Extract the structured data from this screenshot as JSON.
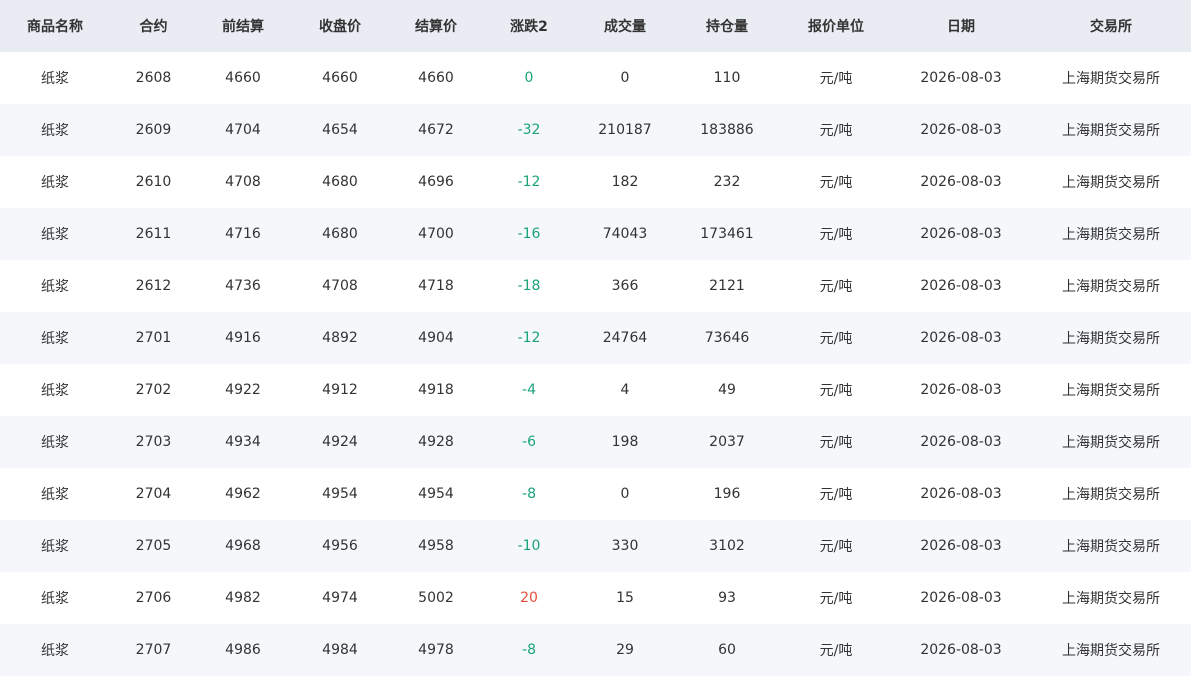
{
  "table": {
    "columns": [
      "商品名称",
      "合约",
      "前结算",
      "收盘价",
      "结算价",
      "涨跌2",
      "成交量",
      "持仓量",
      "报价单位",
      "日期",
      "交易所"
    ],
    "rows": [
      [
        "纸浆",
        "2608",
        "4660",
        "4660",
        "4660",
        "0",
        "0",
        "110",
        "元/吨",
        "2026-08-03",
        "上海期货交易所"
      ],
      [
        "纸浆",
        "2609",
        "4704",
        "4654",
        "4672",
        "-32",
        "210187",
        "183886",
        "元/吨",
        "2026-08-03",
        "上海期货交易所"
      ],
      [
        "纸浆",
        "2610",
        "4708",
        "4680",
        "4696",
        "-12",
        "182",
        "232",
        "元/吨",
        "2026-08-03",
        "上海期货交易所"
      ],
      [
        "纸浆",
        "2611",
        "4716",
        "4680",
        "4700",
        "-16",
        "74043",
        "173461",
        "元/吨",
        "2026-08-03",
        "上海期货交易所"
      ],
      [
        "纸浆",
        "2612",
        "4736",
        "4708",
        "4718",
        "-18",
        "366",
        "2121",
        "元/吨",
        "2026-08-03",
        "上海期货交易所"
      ],
      [
        "纸浆",
        "2701",
        "4916",
        "4892",
        "4904",
        "-12",
        "24764",
        "73646",
        "元/吨",
        "2026-08-03",
        "上海期货交易所"
      ],
      [
        "纸浆",
        "2702",
        "4922",
        "4912",
        "4918",
        "-4",
        "4",
        "49",
        "元/吨",
        "2026-08-03",
        "上海期货交易所"
      ],
      [
        "纸浆",
        "2703",
        "4934",
        "4924",
        "4928",
        "-6",
        "198",
        "2037",
        "元/吨",
        "2026-08-03",
        "上海期货交易所"
      ],
      [
        "纸浆",
        "2704",
        "4962",
        "4954",
        "4954",
        "-8",
        "0",
        "196",
        "元/吨",
        "2026-08-03",
        "上海期货交易所"
      ],
      [
        "纸浆",
        "2705",
        "4968",
        "4956",
        "4958",
        "-10",
        "330",
        "3102",
        "元/吨",
        "2026-08-03",
        "上海期货交易所"
      ],
      [
        "纸浆",
        "2706",
        "4982",
        "4974",
        "5002",
        "20",
        "15",
        "93",
        "元/吨",
        "2026-08-03",
        "上海期货交易所"
      ],
      [
        "纸浆",
        "2707",
        "4986",
        "4984",
        "4978",
        "-8",
        "29",
        "60",
        "元/吨",
        "2026-08-03",
        "上海期货交易所"
      ]
    ],
    "colors": {
      "header_bg": "#e9ecf3",
      "row_alt_bg": "#f5f7fa",
      "up": "#e74c3c",
      "down": "#1aa37a"
    }
  }
}
